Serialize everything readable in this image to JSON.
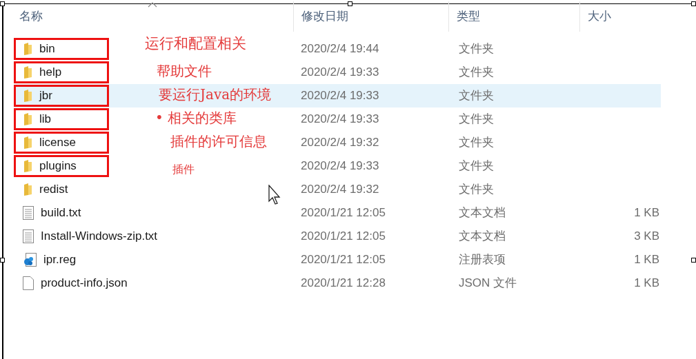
{
  "columns": [
    {
      "label": "名称",
      "sorted": true
    },
    {
      "label": "修改日期",
      "sorted": false
    },
    {
      "label": "类型",
      "sorted": false
    },
    {
      "label": "大小",
      "sorted": false
    }
  ],
  "files": [
    {
      "name": "bin",
      "kind": "folder",
      "date": "2020/2/4 19:44",
      "type": "文件夹",
      "boxed": true,
      "highlighted": false,
      "note": "运行和配置相关"
    },
    {
      "name": "help",
      "kind": "folder",
      "date": "2020/2/4 19:33",
      "type": "文件夹",
      "boxed": true,
      "highlighted": false,
      "note": "帮助文件"
    },
    {
      "name": "jbr",
      "kind": "folder",
      "date": "2020/2/4 19:33",
      "type": "文件夹",
      "boxed": true,
      "highlighted": true,
      "note": "要运行Java的环境"
    },
    {
      "name": "lib",
      "kind": "folder",
      "date": "2020/2/4 19:33",
      "type": "文件夹",
      "boxed": true,
      "highlighted": false,
      "note": "• 相关的类库"
    },
    {
      "name": "license",
      "kind": "folder",
      "date": "2020/2/4 19:32",
      "type": "文件夹",
      "boxed": true,
      "highlighted": false,
      "note": "插件的许可信息"
    },
    {
      "name": "plugins",
      "kind": "folder",
      "date": "2020/2/4 19:33",
      "type": "文件夹",
      "boxed": true,
      "highlighted": false,
      "note": "插件"
    },
    {
      "name": "redist",
      "kind": "folder",
      "date": "2020/2/4 19:32",
      "type": "文件夹",
      "boxed": false,
      "highlighted": false
    },
    {
      "name": "build.txt",
      "kind": "text",
      "date": "2020/1/21 12:05",
      "type": "文本文档",
      "size": "1 KB",
      "boxed": false,
      "highlighted": false
    },
    {
      "name": "Install-Windows-zip.txt",
      "kind": "text",
      "date": "2020/1/21 12:05",
      "type": "文本文档",
      "size": "3 KB",
      "boxed": false,
      "highlighted": false
    },
    {
      "name": "ipr.reg",
      "kind": "registry",
      "date": "2020/1/21 12:05",
      "type": "注册表项",
      "size": "1 KB",
      "boxed": false,
      "highlighted": false
    },
    {
      "name": "product-info.json",
      "kind": "file",
      "date": "2020/1/21 12:28",
      "type": "JSON 文件",
      "size": "1 KB",
      "boxed": false,
      "highlighted": false
    }
  ]
}
